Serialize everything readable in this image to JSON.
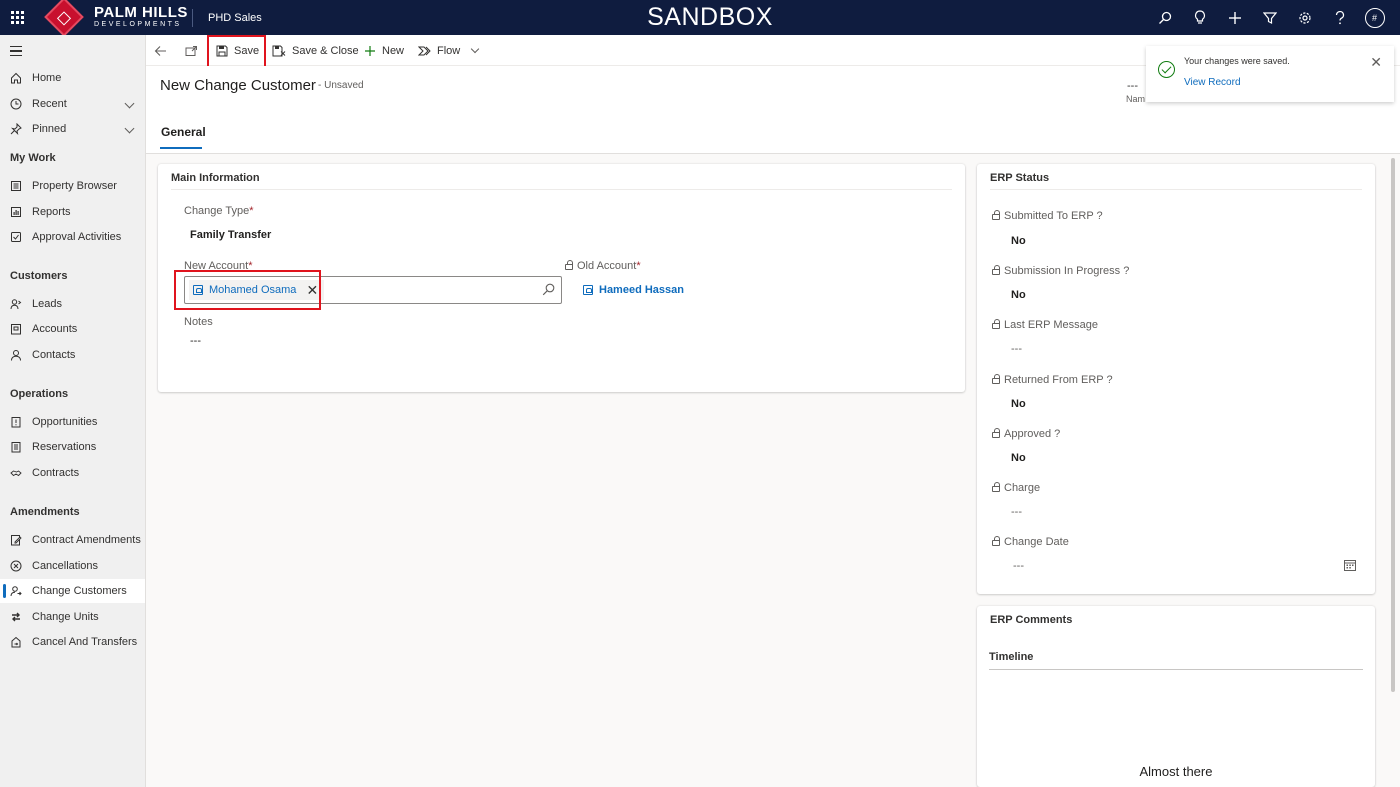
{
  "topbar": {
    "brand_line1": "PALM HILLS",
    "brand_line2": "DEVELOPMENTS",
    "app_name": "PHD Sales",
    "environment": "SANDBOX",
    "icons": [
      "search-icon",
      "lightbulb-icon",
      "plus-icon",
      "filter-icon",
      "gear-icon",
      "help-icon"
    ],
    "avatar_initial": "#"
  },
  "sidebar": {
    "top_items": [
      {
        "label": "Home",
        "icon": "home-icon"
      },
      {
        "label": "Recent",
        "icon": "clock-icon"
      },
      {
        "label": "Pinned",
        "icon": "pin-icon"
      }
    ],
    "groups": [
      {
        "title": "My Work",
        "items": [
          "Property Browser",
          "Reports",
          "Approval Activities"
        ]
      },
      {
        "title": "Customers",
        "items": [
          "Leads",
          "Accounts",
          "Contacts"
        ]
      },
      {
        "title": "Operations",
        "items": [
          "Opportunities",
          "Reservations",
          "Contracts"
        ]
      },
      {
        "title": "Amendments",
        "items": [
          "Contract Amendments",
          "Cancellations",
          "Change Customers",
          "Change Units",
          "Cancel And Transfers"
        ]
      }
    ],
    "active_item": "Change Customers"
  },
  "commandbar": {
    "save": "Save",
    "save_close": "Save & Close",
    "new": "New",
    "flow": "Flow"
  },
  "header": {
    "title": "New Change Customer",
    "status": "- Unsaved",
    "field_value": "---",
    "field_label": "Nam",
    "tab_general": "General"
  },
  "toast": {
    "message": "Your changes were saved.",
    "link": "View Record"
  },
  "main_info": {
    "title": "Main Information",
    "change_type_label": "Change Type",
    "change_type_value": "Family Transfer",
    "new_account_label": "New Account",
    "new_account_value": "Mohamed Osama",
    "old_account_label": "Old Account",
    "old_account_value": "Hameed Hassan",
    "notes_label": "Notes",
    "notes_value": "---",
    "required_mark": "*"
  },
  "erp_status": {
    "title": "ERP Status",
    "fields": [
      {
        "label": "Submitted To ERP ?",
        "value": "No"
      },
      {
        "label": "Submission In Progress ?",
        "value": "No"
      },
      {
        "label": "Last ERP Message",
        "value": "---"
      },
      {
        "label": "Returned From ERP ?",
        "value": "No"
      },
      {
        "label": "Approved ?",
        "value": "No"
      },
      {
        "label": "Charge",
        "value": "---"
      },
      {
        "label": "Change Date",
        "value": "---"
      }
    ]
  },
  "erp_comments": {
    "title": "ERP Comments",
    "timeline": "Timeline",
    "loading_text": "Almost there"
  }
}
